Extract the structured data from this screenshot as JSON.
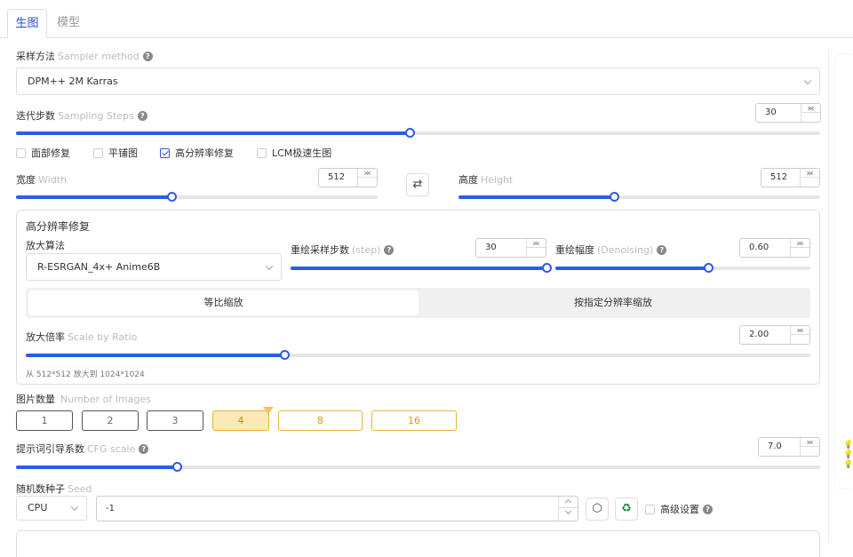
{
  "tabs": [
    {
      "label": "生图"
    },
    {
      "label": "模型"
    }
  ],
  "sampler": {
    "label": "采样方法",
    "label_en": "Sampler method",
    "value": "DPM++ 2M Karras"
  },
  "steps": {
    "label": "迭代步数",
    "label_en": "Sampling Steps",
    "value": "30",
    "fraction": 0.49
  },
  "checks": [
    {
      "label": "面部修复",
      "checked": false
    },
    {
      "label": "平铺图",
      "checked": false
    },
    {
      "label": "高分辨率修复",
      "checked": true
    },
    {
      "label": "LCM极速生图",
      "checked": false
    }
  ],
  "width": {
    "label": "宽度",
    "label_en": "Width",
    "value": "512",
    "fraction": 0.43
  },
  "height": {
    "label": "高度",
    "label_en": "Height",
    "value": "512",
    "fraction": 0.43
  },
  "hires": {
    "title": "高分辨率修复",
    "upscaler_label": "放大算法",
    "upscaler_value": "R-ESRGAN_4x+ Anime6B",
    "step_label": "重绘采样步数",
    "step_label_en": "(step)",
    "step_value": "30",
    "step_fraction": 1.0,
    "denoise_label": "重绘幅度",
    "denoise_label_en": "(Denoising)",
    "denoise_value": "0.60",
    "denoise_fraction": 0.6,
    "seg_options": [
      "等比缩放",
      "按指定分辨率缩放"
    ],
    "scale_label": "放大倍率",
    "scale_label_en": "Scale by Ratio",
    "scale_value": "2.00",
    "scale_fraction": 0.33,
    "hint": "从 512*512 放大到 1024*1024"
  },
  "images": {
    "label": "图片数量",
    "label_en": "Number of Images",
    "options": [
      "1",
      "2",
      "3",
      "4",
      "8",
      "16"
    ],
    "selected": "4"
  },
  "cfg": {
    "label": "提示词引导系数",
    "label_en": "CFG scale",
    "value": "7.0",
    "fraction": 0.2
  },
  "seed": {
    "label": "随机数种子",
    "label_en": "Seed",
    "device": "CPU",
    "value": "-1",
    "advanced_label": "高级设置"
  },
  "colors": {
    "accent": "#2e5bea",
    "gold": "#e9b43c"
  }
}
